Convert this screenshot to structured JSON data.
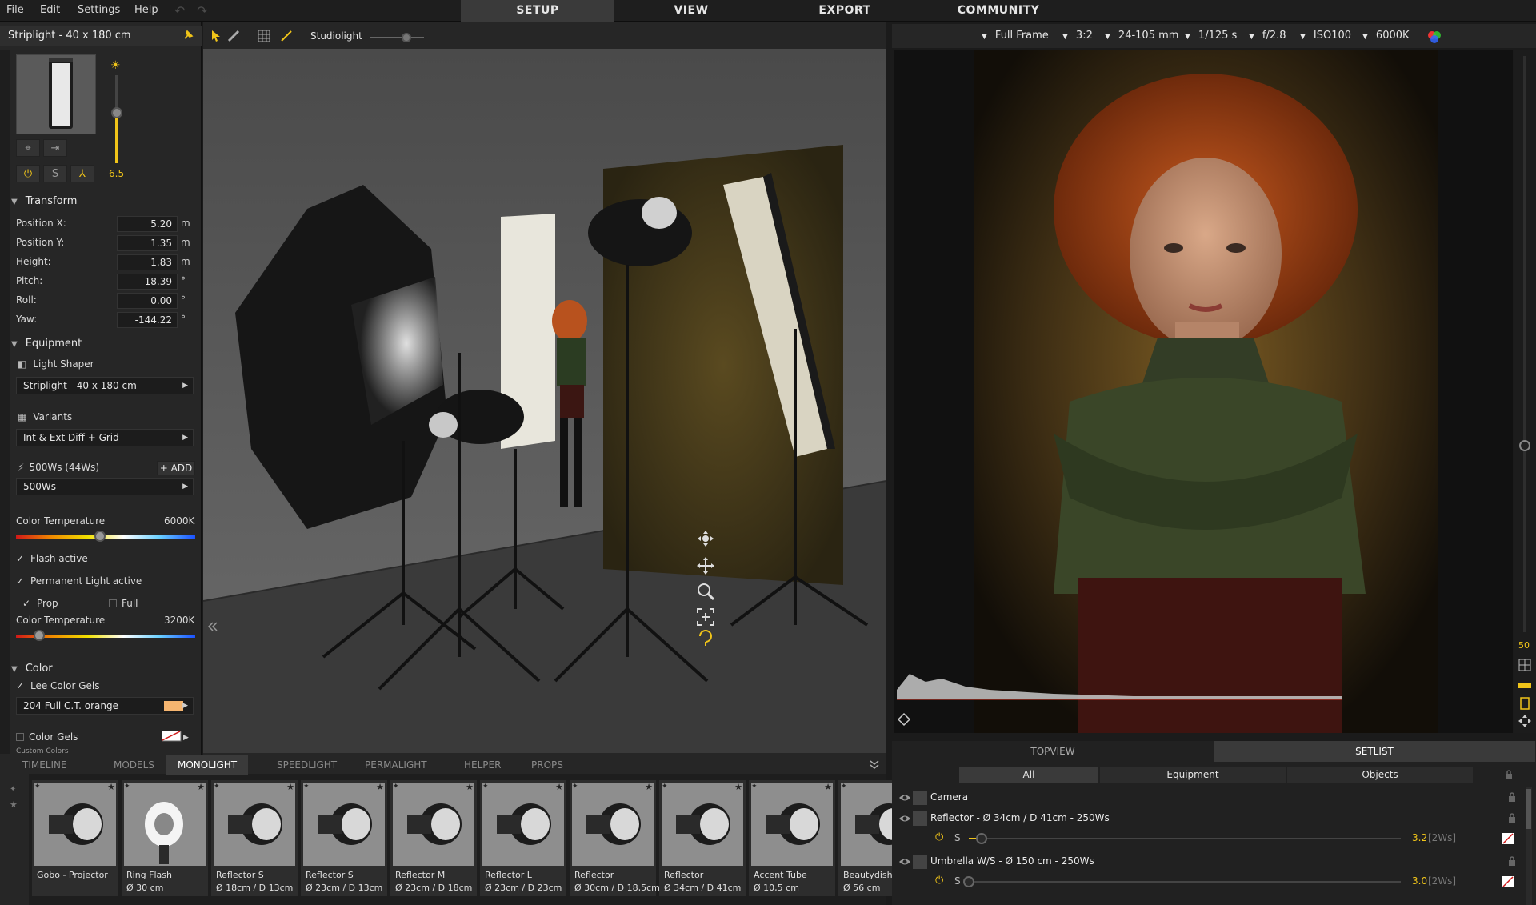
{
  "menu": [
    "File",
    "Edit",
    "Settings",
    "Help"
  ],
  "main_tabs": [
    "SETUP",
    "VIEW",
    "EXPORT",
    "COMMUNITY"
  ],
  "panel": {
    "title": "Striplight - 40 x 180 cm",
    "intensity": "6.5",
    "power_s": "S",
    "transform": {
      "heading": "Transform",
      "rows": [
        {
          "label": "Position X:",
          "value": "5.20",
          "unit": "m"
        },
        {
          "label": "Position Y:",
          "value": "1.35",
          "unit": "m"
        },
        {
          "label": "Height:",
          "value": "1.83",
          "unit": "m"
        },
        {
          "label": "Pitch:",
          "value": "18.39",
          "unit": "°"
        },
        {
          "label": "Roll:",
          "value": "0.00",
          "unit": "°"
        },
        {
          "label": "Yaw:",
          "value": "-144.22",
          "unit": "°"
        }
      ]
    },
    "equipment": {
      "heading": "Equipment",
      "light_shaper_label": "Light Shaper",
      "light_shaper_value": "Striplight - 40 x 180 cm",
      "variants_label": "Variants",
      "variants_value": "Int & Ext Diff + Grid",
      "power_label": "500Ws (44Ws)",
      "add_label": "ADD",
      "power_value": "500Ws",
      "color_temp_label": "Color Temperature",
      "color_temp_value": "6000K",
      "color_temp_level": 0.47,
      "flash_active": "Flash active",
      "permanent_active": "Permanent Light active",
      "prop": "Prop",
      "full": "Full",
      "color_temp2_label": "Color Temperature",
      "color_temp2_value": "3200K",
      "color_temp2_level": 0.13
    },
    "color": {
      "heading": "Color",
      "lee_label": "Lee Color Gels",
      "lee_value": "204 Full C.T. orange",
      "lee_swatch": "#f5b570",
      "gels_label": "Color Gels",
      "custom_label": "Custom Colors"
    }
  },
  "viewport": {
    "preset": "Studiolight"
  },
  "library": {
    "tabs": [
      "TIMELINE",
      "MODELS",
      "MONOLIGHT",
      "SPEEDLIGHT",
      "PERMALIGHT",
      "HELPER",
      "PROPS"
    ],
    "active_tab": "MONOLIGHT",
    "items": [
      {
        "name": "Gobo - Projector",
        "sub": ""
      },
      {
        "name": "Ring Flash",
        "sub": "Ø 30 cm"
      },
      {
        "name": "Reflector S",
        "sub": "Ø 18cm / D 13cm"
      },
      {
        "name": "Reflector S",
        "sub": "Ø 23cm / D 13cm"
      },
      {
        "name": "Reflector M",
        "sub": "Ø 23cm / D 18cm"
      },
      {
        "name": "Reflector L",
        "sub": "Ø 23cm / D 23cm"
      },
      {
        "name": "Reflector",
        "sub": "Ø 30cm / D 18,5cm"
      },
      {
        "name": "Reflector",
        "sub": "Ø 34cm / D 41cm"
      },
      {
        "name": "Accent Tube",
        "sub": "Ø 10,5 cm"
      },
      {
        "name": "Beautydish",
        "sub": "Ø 56 cm"
      }
    ]
  },
  "camera": {
    "sensor": "Full Frame",
    "ratio": "3:2",
    "lens": "24-105 mm",
    "shutter": "1/125 s",
    "aperture": "f/2.8",
    "iso": "ISO100",
    "wb": "6000K",
    "zoom_label": "50"
  },
  "setlist": {
    "tabs": [
      "TOPVIEW",
      "SETLIST"
    ],
    "active_tab": "SETLIST",
    "filters": [
      "All",
      "Equipment",
      "Objects"
    ],
    "rows": [
      {
        "name": "Camera"
      },
      {
        "name": "Reflector - Ø 34cm / D 41cm - 250Ws",
        "s": "S",
        "value": "3.2",
        "unit": "[2Ws]",
        "level": 0.03
      },
      {
        "name": "Umbrella W/S - Ø 150 cm - 250Ws",
        "s": "S",
        "value": "3.0",
        "unit": "[2Ws]",
        "level": 0.0
      }
    ]
  }
}
